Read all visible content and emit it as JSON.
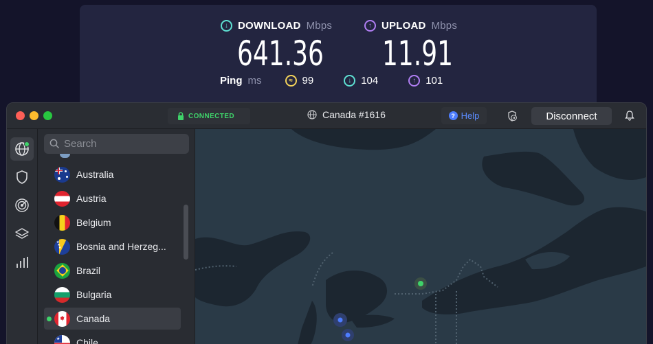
{
  "speedtest": {
    "download": {
      "label": "DOWNLOAD",
      "unit": "Mbps",
      "value": "641.36"
    },
    "upload": {
      "label": "UPLOAD",
      "unit": "Mbps",
      "value": "11.91"
    },
    "ping": {
      "label": "Ping",
      "unit": "ms",
      "idle": "99",
      "download": "104",
      "upload": "101"
    }
  },
  "vpn": {
    "status": "CONNECTED",
    "server": "Canada #1616",
    "help_label": "Help",
    "disconnect_label": "Disconnect",
    "search_placeholder": "Search",
    "countries": [
      {
        "name": "Australia",
        "flag": "australia"
      },
      {
        "name": "Austria",
        "flag": "austria"
      },
      {
        "name": "Belgium",
        "flag": "belgium"
      },
      {
        "name": "Bosnia and Herzeg...",
        "flag": "bosnia"
      },
      {
        "name": "Brazil",
        "flag": "brazil"
      },
      {
        "name": "Bulgaria",
        "flag": "bulgaria"
      },
      {
        "name": "Canada",
        "flag": "canada",
        "selected": true
      },
      {
        "name": "Chile",
        "flag": "chile"
      }
    ],
    "colors": {
      "connected": "#3fd36a",
      "accent": "#5b8cff",
      "map_land": "#2a3a47",
      "map_water": "#1c2630"
    }
  }
}
